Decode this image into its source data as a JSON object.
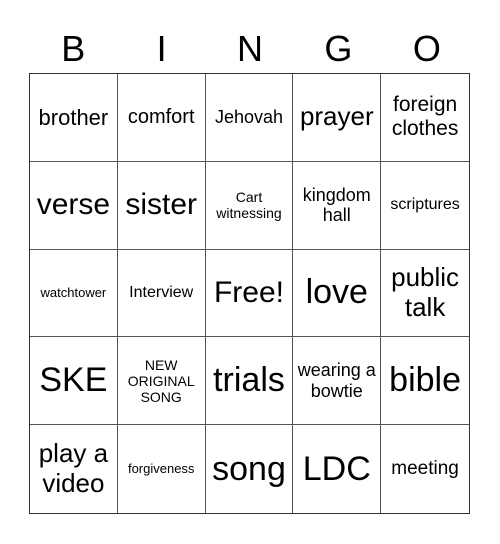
{
  "header": [
    "B",
    "I",
    "N",
    "G",
    "O"
  ],
  "cells": [
    {
      "text": "brother",
      "size": 22
    },
    {
      "text": "comfort",
      "size": 20
    },
    {
      "text": "Jehovah",
      "size": 18
    },
    {
      "text": "prayer",
      "size": 26
    },
    {
      "text": "foreign clothes",
      "size": 21
    },
    {
      "text": "verse",
      "size": 30
    },
    {
      "text": "sister",
      "size": 30
    },
    {
      "text": "Cart witnessing",
      "size": 14
    },
    {
      "text": "kingdom hall",
      "size": 18
    },
    {
      "text": "scriptures",
      "size": 16
    },
    {
      "text": "watchtower",
      "size": 13
    },
    {
      "text": "Interview",
      "size": 16
    },
    {
      "text": "Free!",
      "size": 30
    },
    {
      "text": "love",
      "size": 34
    },
    {
      "text": "public talk",
      "size": 26
    },
    {
      "text": "SKE",
      "size": 34
    },
    {
      "text": "NEW ORIGINAL SONG",
      "size": 14
    },
    {
      "text": "trials",
      "size": 34
    },
    {
      "text": "wearing a bowtie",
      "size": 18
    },
    {
      "text": "bible",
      "size": 34
    },
    {
      "text": "play a video",
      "size": 26
    },
    {
      "text": "forgiveness",
      "size": 13
    },
    {
      "text": "song",
      "size": 34
    },
    {
      "text": "LDC",
      "size": 34
    },
    {
      "text": "meeting",
      "size": 19
    }
  ]
}
